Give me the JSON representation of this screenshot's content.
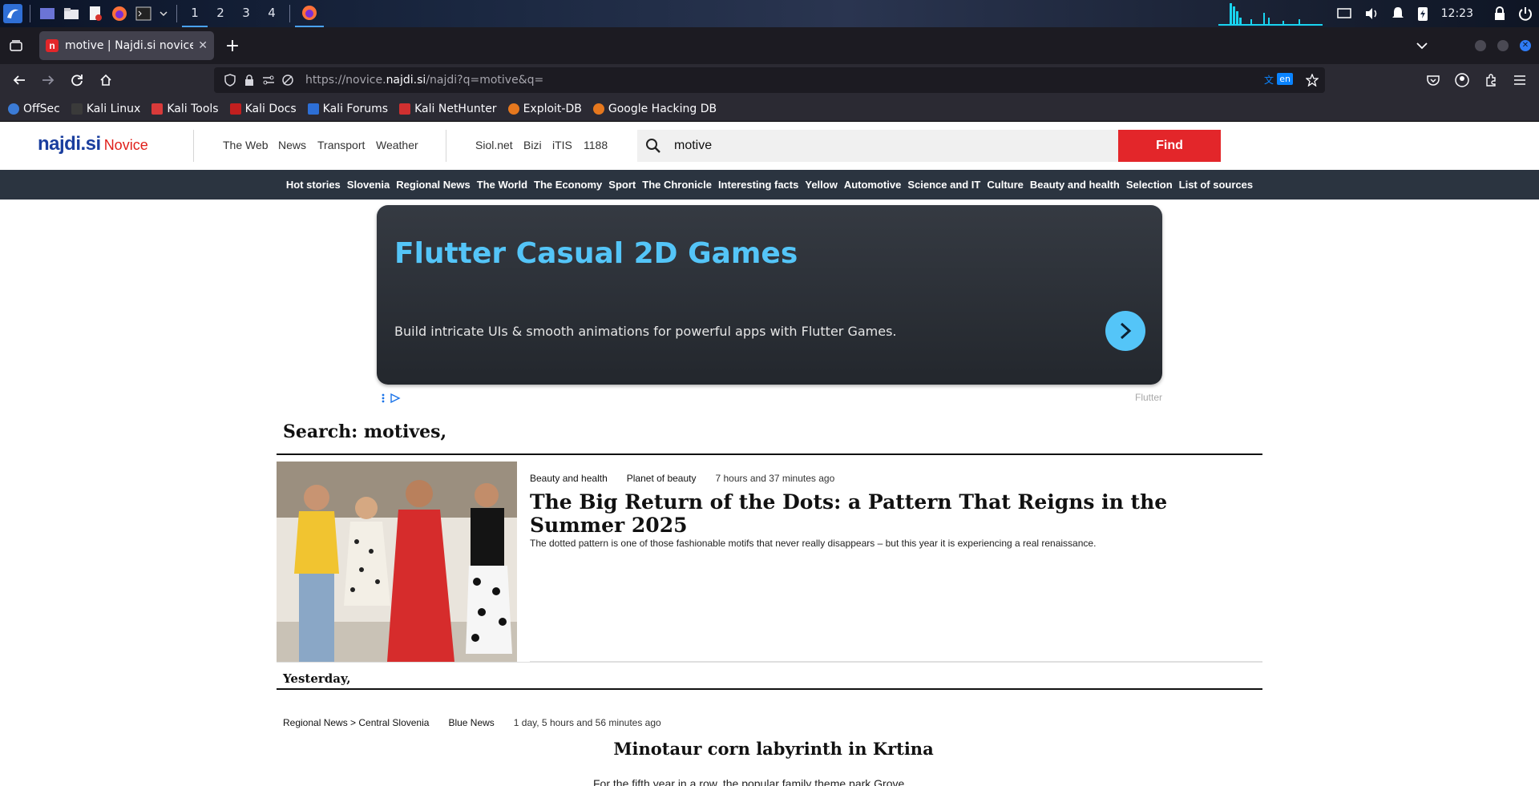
{
  "taskbar": {
    "workspaces": [
      "1",
      "2",
      "3",
      "4"
    ],
    "active_workspace": "1",
    "clock": "12:23",
    "launcher_icons": [
      "kali-menu-icon",
      "desktop-icon",
      "file-manager-icon",
      "text-editor-icon",
      "firefox-icon",
      "terminal-icon"
    ]
  },
  "browser": {
    "tab_title": "motive | Najdi.si novice",
    "url_prefix": "https://novice.",
    "url_domain": "najdi.si",
    "url_path": "/najdi?q=motive&q=",
    "translate_lang": "en",
    "bookmarks": [
      {
        "label": "OffSec",
        "color": "#3b7bd6"
      },
      {
        "label": "Kali Linux",
        "color": "#3a3a3a"
      },
      {
        "label": "Kali Tools",
        "color": "#d93a3a"
      },
      {
        "label": "Kali Docs",
        "color": "#c21f1f"
      },
      {
        "label": "Kali Forums",
        "color": "#2d6fd6"
      },
      {
        "label": "Kali NetHunter",
        "color": "#d13030"
      },
      {
        "label": "Exploit-DB",
        "color": "#e6781e"
      },
      {
        "label": "Google Hacking DB",
        "color": "#e6781e"
      }
    ]
  },
  "site": {
    "logo_brand": "najdi.si",
    "logo_sub": "Novice",
    "nav_primary": [
      "The Web",
      "News",
      "Transport",
      "Weather"
    ],
    "nav_secondary": [
      "Siol.net",
      "Bizi",
      "iTIS",
      "1188"
    ],
    "search_value": "motive",
    "find_label": "Find",
    "categories": [
      "Hot stories",
      "Slovenia",
      "Regional News",
      "The World",
      "The Economy",
      "Sport",
      "The Chronicle",
      "Interesting facts",
      "Yellow",
      "Automotive",
      "Science and IT",
      "Culture",
      "Beauty and health",
      "Selection",
      "List of sources"
    ]
  },
  "ad": {
    "title": "Flutter Casual 2D Games",
    "text": "Build intricate UIs & smooth animations for powerful apps with Flutter Games.",
    "sponsor": "Flutter"
  },
  "results": {
    "heading": "Search: motives,",
    "articles": [
      {
        "category": "Beauty and health",
        "source": "Planet of beauty",
        "time": "7 hours and 37 minutes ago",
        "title": "The Big Return of the Dots: a Pattern That Reigns in the Summer 2025",
        "excerpt": "The dotted pattern is one of those fashionable motifs that never really disappears – but this year it is experiencing a real renaissance."
      },
      {
        "category": "Regional News > Central Slovenia",
        "source": "Blue News",
        "time": "1 day, 5 hours and 56 minutes ago",
        "title": "Minotaur corn labyrinth in Krtina",
        "excerpt": "For the fifth year in a row, the popular family theme park Grove"
      }
    ],
    "section_yesterday": "Yesterday,"
  }
}
